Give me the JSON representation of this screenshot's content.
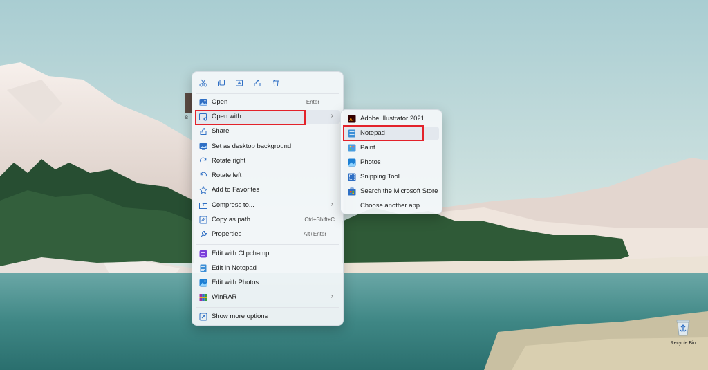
{
  "desktop": {
    "recycle_bin_label": "Recycle Bin",
    "file_label_fragment": "B"
  },
  "context_menu": {
    "toolbar": [
      {
        "icon": "cut-icon",
        "name": "cut-button"
      },
      {
        "icon": "copy-icon",
        "name": "copy-button"
      },
      {
        "icon": "rename-icon",
        "name": "rename-button"
      },
      {
        "icon": "share-icon",
        "name": "share-toolbar-button"
      },
      {
        "icon": "delete-icon",
        "name": "delete-button"
      }
    ],
    "items": [
      {
        "label": "Open",
        "shortcut": "Enter",
        "icon": "image-icon"
      },
      {
        "label": "Open with",
        "icon": "open-with-icon",
        "submenu": true
      },
      {
        "label": "Share",
        "icon": "share-icon"
      },
      {
        "label": "Set as desktop background",
        "icon": "desktop-background-icon"
      },
      {
        "label": "Rotate right",
        "icon": "rotate-right-icon"
      },
      {
        "label": "Rotate left",
        "icon": "rotate-left-icon"
      },
      {
        "label": "Add to Favorites",
        "icon": "star-icon"
      },
      {
        "label": "Compress to...",
        "icon": "folder-zip-icon",
        "submenu": true
      },
      {
        "label": "Copy as path",
        "shortcut": "Ctrl+Shift+C",
        "icon": "copy-path-icon"
      },
      {
        "label": "Properties",
        "shortcut": "Alt+Enter",
        "icon": "wrench-icon"
      },
      {
        "label": "Edit with Clipchamp",
        "icon": "clipchamp-icon"
      },
      {
        "label": "Edit in Notepad",
        "icon": "notepad-icon"
      },
      {
        "label": "Edit with Photos",
        "icon": "photos-icon"
      },
      {
        "label": "WinRAR",
        "icon": "winrar-icon",
        "submenu": true
      },
      {
        "label": "Show more options",
        "icon": "more-options-icon"
      }
    ]
  },
  "submenu": {
    "items": [
      {
        "label": "Adobe Illustrator 2021",
        "icon": "illustrator-icon"
      },
      {
        "label": "Notepad",
        "icon": "notepad-icon"
      },
      {
        "label": "Paint",
        "icon": "paint-icon"
      },
      {
        "label": "Photos",
        "icon": "photos-icon"
      },
      {
        "label": "Snipping Tool",
        "icon": "snipping-tool-icon"
      },
      {
        "label": "Search the Microsoft Store",
        "icon": "store-icon"
      },
      {
        "label": "Choose another app",
        "icon": ""
      }
    ]
  },
  "colors": {
    "highlight_box": "#e3222a",
    "menu_background": "#f3f6f9",
    "icon_accent": "#2f6fc4"
  },
  "arrow_glyph": "›"
}
